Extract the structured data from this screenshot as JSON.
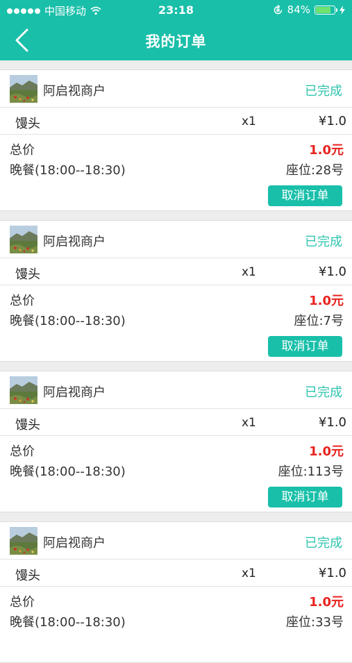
{
  "status_bar": {
    "carrier": "中国移动",
    "time": "23:18",
    "battery": "84%",
    "battery_level": 0.84
  },
  "header": {
    "title": "我的订单"
  },
  "colors": {
    "brand": "#19bfa9",
    "completed": "#2fc4ae",
    "price_red": "#e8231f"
  },
  "orders": [
    {
      "shop": "阿启视商户",
      "status": "已完成",
      "item": "馒头",
      "qty": "x1",
      "price": "¥1.0",
      "total_label": "总价",
      "total": "1.0元",
      "meal": "晚餐(18:00--18:30)",
      "seat": "座位:28号",
      "cancel": "取消订单"
    },
    {
      "shop": "阿启视商户",
      "status": "已完成",
      "item": "馒头",
      "qty": "x1",
      "price": "¥1.0",
      "total_label": "总价",
      "total": "1.0元",
      "meal": "晚餐(18:00--18:30)",
      "seat": "座位:7号",
      "cancel": "取消订单"
    },
    {
      "shop": "阿启视商户",
      "status": "已完成",
      "item": "馒头",
      "qty": "x1",
      "price": "¥1.0",
      "total_label": "总价",
      "total": "1.0元",
      "meal": "晚餐(18:00--18:30)",
      "seat": "座位:113号",
      "cancel": "取消订单"
    },
    {
      "shop": "阿启视商户",
      "status": "已完成",
      "item": "馒头",
      "qty": "x1",
      "price": "¥1.0",
      "total_label": "总价",
      "total": "1.0元",
      "meal": "晚餐(18:00--18:30)",
      "seat": "座位:33号"
    }
  ]
}
